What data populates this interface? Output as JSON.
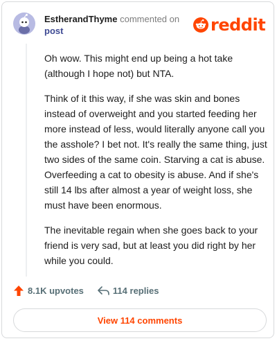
{
  "brand": {
    "name": "reddit",
    "color": "#ff4500"
  },
  "comment": {
    "author": "EstherandThyme",
    "action_text": "commented on",
    "target_text": "post",
    "paragraphs": [
      "Oh wow. This might end up being a hot take (although I hope not) but NTA.",
      "Think of it this way, if she was skin and bones instead of overweight and you started feeding her more instead of less, would literally anyone call you the asshole? I bet not. It's really the same thing, just two sides of the same coin. Starving a cat is abuse. Overfeeding a cat to obesity is abuse. And if she's still 14 lbs after almost a year of weight loss, she must have been enormous.",
      "The inevitable regain when she goes back to your friend is very sad, but at least you did right by her while you could."
    ]
  },
  "actions": {
    "upvotes_label": "8.1K upvotes",
    "replies_label": "114 replies",
    "upvote_icon": "upvote-arrow-icon",
    "reply_icon": "reply-arrow-icon"
  },
  "view_comments_label": "View 114 comments",
  "colors": {
    "accent": "#ff4500",
    "link": "#3e4a94",
    "muted": "#7c7c7c",
    "avatar_bg": "#b8bbe3"
  }
}
